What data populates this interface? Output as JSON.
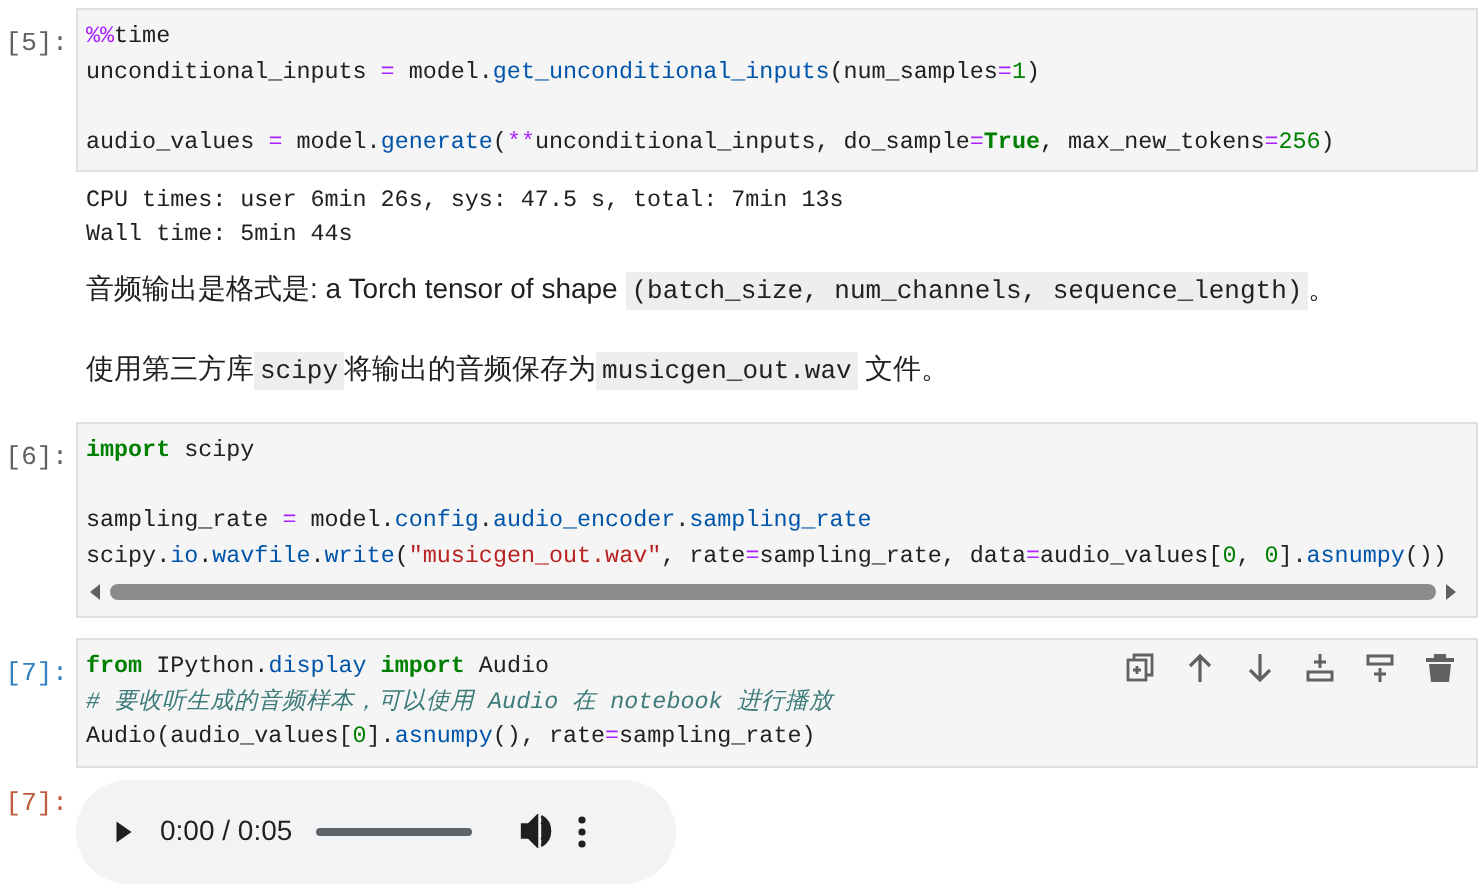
{
  "cells": [
    {
      "kind": "code",
      "prompt": "[5]:",
      "lines": [
        {
          "tokens": [
            {
              "kind": "magic",
              "text": "%%"
            },
            {
              "text": "time"
            }
          ]
        },
        {
          "tokens": [
            {
              "text": "unconditional_inputs "
            },
            {
              "kind": "op",
              "text": "="
            },
            {
              "text": " model."
            },
            {
              "kind": "fn",
              "text": "get_unconditional_inputs"
            },
            {
              "text": "(num_samples"
            },
            {
              "kind": "op",
              "text": "="
            },
            {
              "kind": "num",
              "text": "1"
            },
            {
              "text": ")"
            }
          ]
        },
        {
          "gap_before": true,
          "tokens": [
            {
              "text": "audio_values "
            },
            {
              "kind": "op",
              "text": "="
            },
            {
              "text": " model."
            },
            {
              "kind": "fn",
              "text": "generate"
            },
            {
              "text": "("
            },
            {
              "kind": "op",
              "text": "**"
            },
            {
              "text": "unconditional_inputs, do_sample"
            },
            {
              "kind": "op",
              "text": "="
            },
            {
              "kind": "kw",
              "text": "True"
            },
            {
              "text": ", max_new_tokens"
            },
            {
              "kind": "op",
              "text": "="
            },
            {
              "kind": "num",
              "text": "256"
            },
            {
              "text": ")"
            }
          ]
        }
      ],
      "output": {
        "lines": [
          "CPU times: user 6min 26s, sys: 47.5 s, total: 7min 13s",
          "Wall time: 5min 44s"
        ]
      }
    },
    {
      "kind": "markdown",
      "paragraphs": [
        [
          {
            "text": "音频输出是格式是: a Torch tensor of shape ",
            "code": false
          },
          {
            "text": "(batch_size, num_channels, sequence_length)",
            "code": true
          },
          {
            "text": "。",
            "code": false
          }
        ],
        [
          {
            "text": "使用第三方库",
            "code": false
          },
          {
            "text": "scipy",
            "code": true
          },
          {
            "text": "将输出的音频保存为",
            "code": false
          },
          {
            "text": "musicgen_out.wav",
            "code": true
          },
          {
            "text": " 文件。",
            "code": false
          }
        ]
      ]
    },
    {
      "kind": "code",
      "prompt": "[6]:",
      "scrollbar": true,
      "lines": [
        {
          "tokens": [
            {
              "kind": "kw",
              "text": "import"
            },
            {
              "text": " scipy"
            }
          ]
        },
        {
          "gap_before": true,
          "tokens": [
            {
              "text": "sampling_rate "
            },
            {
              "kind": "op",
              "text": "="
            },
            {
              "text": " model."
            },
            {
              "kind": "fn",
              "text": "config"
            },
            {
              "text": "."
            },
            {
              "kind": "fn",
              "text": "audio_encoder"
            },
            {
              "text": "."
            },
            {
              "kind": "fn",
              "text": "sampling_rate"
            }
          ]
        },
        {
          "tokens": [
            {
              "text": "scipy."
            },
            {
              "kind": "fn",
              "text": "io"
            },
            {
              "text": "."
            },
            {
              "kind": "fn",
              "text": "wavfile"
            },
            {
              "text": "."
            },
            {
              "kind": "fn",
              "text": "write"
            },
            {
              "text": "("
            },
            {
              "kind": "str",
              "text": "\"musicgen_out.wav\""
            },
            {
              "text": ", rate"
            },
            {
              "kind": "op",
              "text": "="
            },
            {
              "text": "sampling_rate, data"
            },
            {
              "kind": "op",
              "text": "="
            },
            {
              "text": "audio_values["
            },
            {
              "kind": "num",
              "text": "0"
            },
            {
              "text": ", "
            },
            {
              "kind": "num",
              "text": "0"
            },
            {
              "text": "]."
            },
            {
              "kind": "fn",
              "text": "asnumpy"
            },
            {
              "text": "())"
            }
          ]
        }
      ]
    },
    {
      "kind": "code",
      "prompt": "[7]:",
      "toolbar": true,
      "lines": [
        {
          "tokens": [
            {
              "kind": "kw",
              "text": "from"
            },
            {
              "text": " IPython."
            },
            {
              "kind": "fn",
              "text": "display"
            },
            {
              "kind": "kw",
              "text": " import"
            },
            {
              "text": " Audio"
            }
          ]
        },
        {
          "tokens": [
            {
              "kind": "cm",
              "text": "# 要收听生成的音频样本，可以使用 Audio 在 notebook 进行播放"
            }
          ]
        },
        {
          "tokens": [
            {
              "text": "Audio(audio_values["
            },
            {
              "kind": "num",
              "text": "0"
            },
            {
              "text": "]."
            },
            {
              "kind": "fn",
              "text": "asnumpy"
            },
            {
              "text": "(), rate"
            },
            {
              "kind": "op",
              "text": "="
            },
            {
              "text": "sampling_rate)"
            }
          ]
        }
      ],
      "output": {
        "prompt": "[7]:",
        "audio": {
          "time": "0:00 / 0:05",
          "level": 0
        }
      }
    }
  ]
}
